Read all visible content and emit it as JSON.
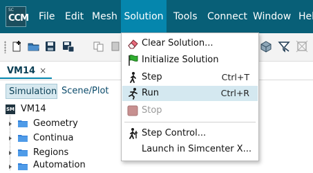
{
  "app": {
    "logo_top": "SC",
    "logo_main": "CCM"
  },
  "menubar": {
    "items": [
      "File",
      "Edit",
      "Mesh",
      "Solution",
      "Tools",
      "Connect",
      "Window",
      "Hel"
    ],
    "active": "Solution",
    "bg_color": "#085f77",
    "active_color": "#0586ad"
  },
  "tabs": {
    "document": "VM14",
    "close_glyph": "×"
  },
  "subtabs": [
    "Simulation",
    "Scene/Plot"
  ],
  "tree": {
    "root": "VM14",
    "root_icon": "SM",
    "children": [
      "Geometry",
      "Continua",
      "Regions",
      "Automation"
    ]
  },
  "solution_menu": {
    "items": [
      {
        "label": "Clear Solution...",
        "icon": "eraser-icon",
        "shortcut": "",
        "enabled": true
      },
      {
        "label": "Initialize Solution",
        "icon": "green-flag-icon",
        "shortcut": "",
        "enabled": true
      },
      {
        "label": "Step",
        "icon": "walking-figure-icon",
        "shortcut": "Ctrl+T",
        "enabled": true
      },
      {
        "label": "Run",
        "icon": "running-figure-icon",
        "shortcut": "Ctrl+R",
        "enabled": true,
        "hovered": true
      },
      {
        "label": "Stop",
        "icon": "stop-square-icon",
        "shortcut": "",
        "enabled": false
      },
      {
        "label": "Step Control...",
        "icon": "step-control-icon",
        "shortcut": "",
        "enabled": true
      },
      {
        "label": "Launch in Simcenter X...",
        "icon": "",
        "shortcut": "",
        "enabled": true
      }
    ],
    "hover_color": "#d4e8f0"
  }
}
